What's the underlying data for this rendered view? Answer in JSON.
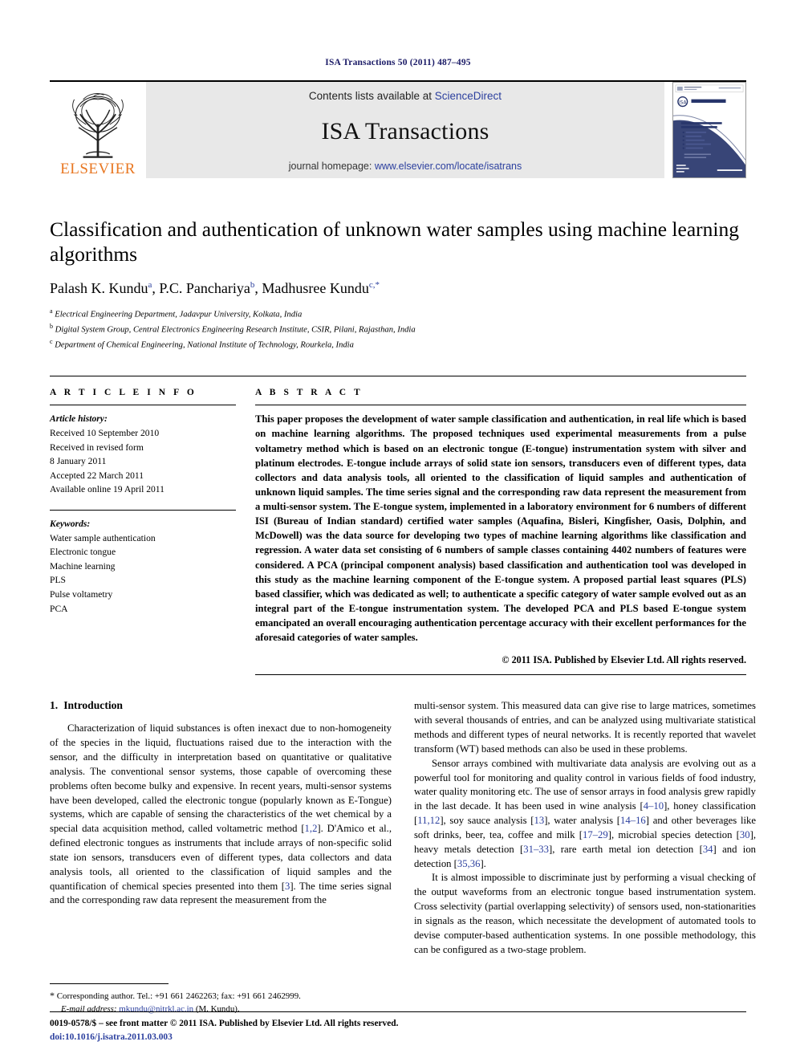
{
  "running_head": "ISA Transactions 50 (2011) 487–495",
  "masthead": {
    "publisher_name": "ELSEVIER",
    "contents_prefix": "Contents lists available at",
    "contents_link": "ScienceDirect",
    "journal_title": "ISA Transactions",
    "homepage_prefix": "journal homepage:",
    "homepage_link": "www.elsevier.com/locate/isatrans",
    "cover_title": "Transactions",
    "cover_subtitle": "The Science and Engineering of Measurement and Automation"
  },
  "article": {
    "title": "Classification and authentication of unknown water samples using machine learning algorithms",
    "authors": [
      {
        "name": "Palash K. Kundu",
        "marker": "a"
      },
      {
        "name": "P.C. Panchariya",
        "marker": "b"
      },
      {
        "name": "Madhusree Kundu",
        "marker": "c,*"
      }
    ],
    "affiliations": [
      {
        "marker": "a",
        "text": "Electrical Engineering Department, Jadavpur University, Kolkata, India"
      },
      {
        "marker": "b",
        "text": "Digital System Group, Central Electronics Engineering Research Institute, CSIR, Pilani, Rajasthan, India"
      },
      {
        "marker": "c",
        "text": "Department of Chemical Engineering, National Institute of Technology, Rourkela, India"
      }
    ]
  },
  "article_info": {
    "heading": "A R T I C L E  I N F O",
    "history_label": "Article history:",
    "history": [
      "Received 10 September 2010",
      "Received in revised form",
      "8 January 2011",
      "Accepted 22 March 2011",
      "Available online 19 April 2011"
    ],
    "keywords_label": "Keywords:",
    "keywords": [
      "Water sample authentication",
      "Electronic tongue",
      "Machine learning",
      "PLS",
      "Pulse voltametry",
      "PCA"
    ]
  },
  "abstract": {
    "heading": "A B S T R A C T",
    "text": "This paper proposes the development of water sample classification and authentication, in real life which is based on machine learning algorithms. The proposed techniques used experimental measurements from a pulse voltametry method which is based on an electronic tongue (E-tongue) instrumentation system with silver and platinum electrodes. E-tongue include arrays of solid state ion sensors, transducers even of different types, data collectors and data analysis tools, all oriented to the classification of liquid samples and authentication of unknown liquid samples. The time series signal and the corresponding raw data represent the measurement from a multi-sensor system. The E-tongue system, implemented in a laboratory environment for 6 numbers of different ISI (Bureau of Indian standard) certified water samples (Aquafina, Bisleri, Kingfisher, Oasis, Dolphin, and McDowell) was the data source for developing two types of machine learning algorithms like classification and regression. A water data set consisting of 6 numbers of sample classes containing 4402 numbers of features were considered. A PCA (principal component analysis) based classification and authentication tool was developed in this study as the machine learning component of the E-tongue system. A proposed partial least squares (PLS) based classifier, which was dedicated as well; to authenticate a specific category of water sample evolved out as an integral part of the E-tongue instrumentation system. The developed PCA and PLS based E-tongue system emancipated an overall encouraging authentication percentage accuracy with their excellent performances for the aforesaid categories of water samples.",
    "copyright": "© 2011 ISA. Published by Elsevier Ltd. All rights reserved."
  },
  "introduction": {
    "number": "1.",
    "heading": "Introduction",
    "left_paragraphs": [
      "Characterization of liquid substances is often inexact due to non-homogeneity of the species in the liquid, fluctuations raised due to the interaction with the sensor, and the difficulty in interpretation based on quantitative or qualitative analysis. The conventional sensor systems, those capable of overcoming these problems often become bulky and expensive. In recent years, multi-sensor systems have been developed, called the electronic tongue (popularly known as E-Tongue) systems, which are capable of sensing the characteristics of the wet chemical by a special data acquisition method, called voltametric method [1,2]. D'Amico et al., defined electronic tongues as instruments that include arrays of non-specific solid state ion sensors, transducers even of different types, data collectors and data analysis tools, all oriented to the classification of liquid samples and the quantification of chemical species presented into them [3]. The time series signal and the corresponding raw data represent the measurement from the"
    ],
    "right_paragraphs": [
      "multi-sensor system. This measured data can give rise to large matrices, sometimes with several thousands of entries, and can be analyzed using multivariate statistical methods and different types of neural networks. It is recently reported that wavelet transform (WT) based methods can also be used in these problems.",
      "Sensor arrays combined with multivariate data analysis are evolving out as a powerful tool for monitoring and quality control in various fields of food industry, water quality monitoring etc. The use of sensor arrays in food analysis grew rapidly in the last decade. It has been used in wine analysis [4–10], honey classification [11,12], soy sauce analysis [13], water analysis [14–16] and other beverages like soft drinks, beer, tea, coffee and milk [17–29], microbial species detection [30], heavy metals detection [31–33], rare earth metal ion detection [34] and ion detection [35,36].",
      "It is almost impossible to discriminate just by performing a visual checking of the output waveforms from an electronic tongue based instrumentation system. Cross selectivity (partial overlapping selectivity) of sensors used, non-stationarities in signals as the reason, which necessitate the development of automated tools to devise computer-based authentication systems. In one possible methodology, this can be configured as a two-stage problem."
    ]
  },
  "footnote": {
    "star": "*",
    "corresponding": "Corresponding author. Tel.: +91 661 2462263; fax: +91 661 2462999.",
    "email_label": "E-mail address:",
    "email": "mkundu@nitrkl.ac.in",
    "email_suffix": "(M. Kundu)."
  },
  "bottom": {
    "issn_line": "0019-0578/$ – see front matter © 2011 ISA. Published by Elsevier Ltd. All rights reserved.",
    "doi_line": "doi:10.1016/j.isatra.2011.03.003"
  },
  "colors": {
    "link": "#2b3f9e",
    "elsevier_orange": "#e87722",
    "masthead_bg": "#e8e8e8",
    "running_head": "#1a1a66"
  }
}
